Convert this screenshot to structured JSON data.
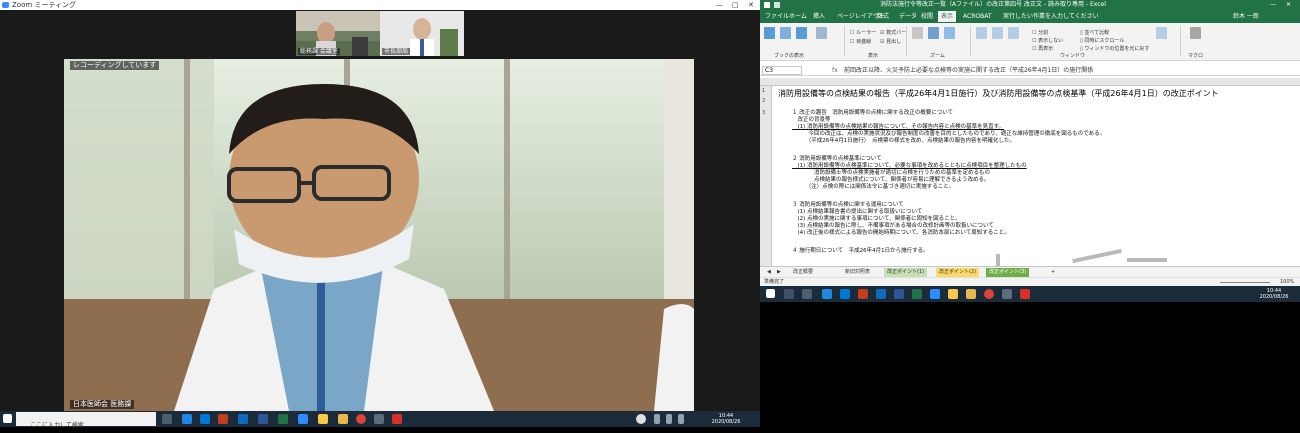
{
  "zoom": {
    "window_title": "Zoom ミーティング",
    "recording_label": "レコーディングしています",
    "participants": [
      {
        "name": "総務課 会議室"
      },
      {
        "name": "市長部局"
      }
    ],
    "speaker_name": "日本医師会 医務課",
    "colors": {
      "accent": "#2d8cff",
      "background": "#1a1a1a"
    }
  },
  "taskbar_left": {
    "search_placeholder": "ここに入力して検索",
    "clock_time": "10:44",
    "clock_date": "2020/08/26"
  },
  "excel": {
    "window_title": "消防法施行令等改正一覧（Aファイル）の改正第四号 改正文 - 読み取り専用 - Excel",
    "ribbon_tabs": [
      "ファイル",
      "ホーム",
      "挿入",
      "ページレイアウト",
      "数式",
      "データ",
      "校閲",
      "表示",
      "ACROBAT",
      "実行したい作業を入力してください"
    ],
    "active_tab": "表示",
    "user_label": "鈴木 一郎",
    "ribbon_groups": [
      "ブックの表示",
      "表示",
      "ズーム",
      "ウィンドウ",
      "マクロ"
    ],
    "name_box": "C3",
    "formula_text": "前回改正以降、火災予防上必要な点検等の実施に関する改正（平成26年4月1日）の施行関係",
    "sheet_title": "消防用設備等の点検結果の報告（平成26年4月1日施行）及び消防用設備等の点検基準（平成26年4月1日）の改正ポイント",
    "lines": [
      "１ 改正の趣旨　消防用設備等の点検に関する改正の概要について",
      "　改正の背景等",
      "　(1) 消防用設備等の点検結果の報告について、その報告内容と点検の基準を見直す。",
      "　　　今回の改正は、点検の実施状況及び報告制度の改善を目的としたものであり、適正な維持管理の徹底を図るものである。",
      "　　　（平成26年4月1日施行）　点検票の様式を改め、点検結果の報告内容を明確化した。",
      "",
      "２ 消防用設備等の点検基準について",
      "　(1) 消防用設備等の点検基準について、必要な事項を改めるとともに点検項目を整理したもの",
      "　　　　消防設備士等の点検実施者が適切に点検を行うための基準を定めるもの",
      "　　　　点検結果の報告様式について、関係者が容易に理解できるよう改める。",
      "　　　（注）点検の際には関係法令に基づき適切に実施すること。",
      "",
      "３ 消防用設備等の点検に関する運用について",
      "　(1) 点検結果報告書の提出に関する取扱いについて",
      "　(2) 点検の実施に関する事項について、関係者に周知を図ること。",
      "　(3) 点検結果の報告に際し、不備事項がある場合の改修計画等の取扱いについて",
      "　(4) 改正後の様式による報告の開始時期について、各消防本部において周知すること。",
      "",
      "４ 施行期日について　平成26年4月1日から施行する。"
    ],
    "sheet_tabs": [
      "改正概要",
      "新旧対照表",
      "改正ポイント(1)",
      "改正ポイント(2)",
      "改正ポイント(3)",
      "+"
    ],
    "status_left": "準備完了",
    "zoom_level": "100%"
  },
  "taskbar_right": {
    "clock_time": "10:44",
    "clock_date": "2020/08/26"
  }
}
